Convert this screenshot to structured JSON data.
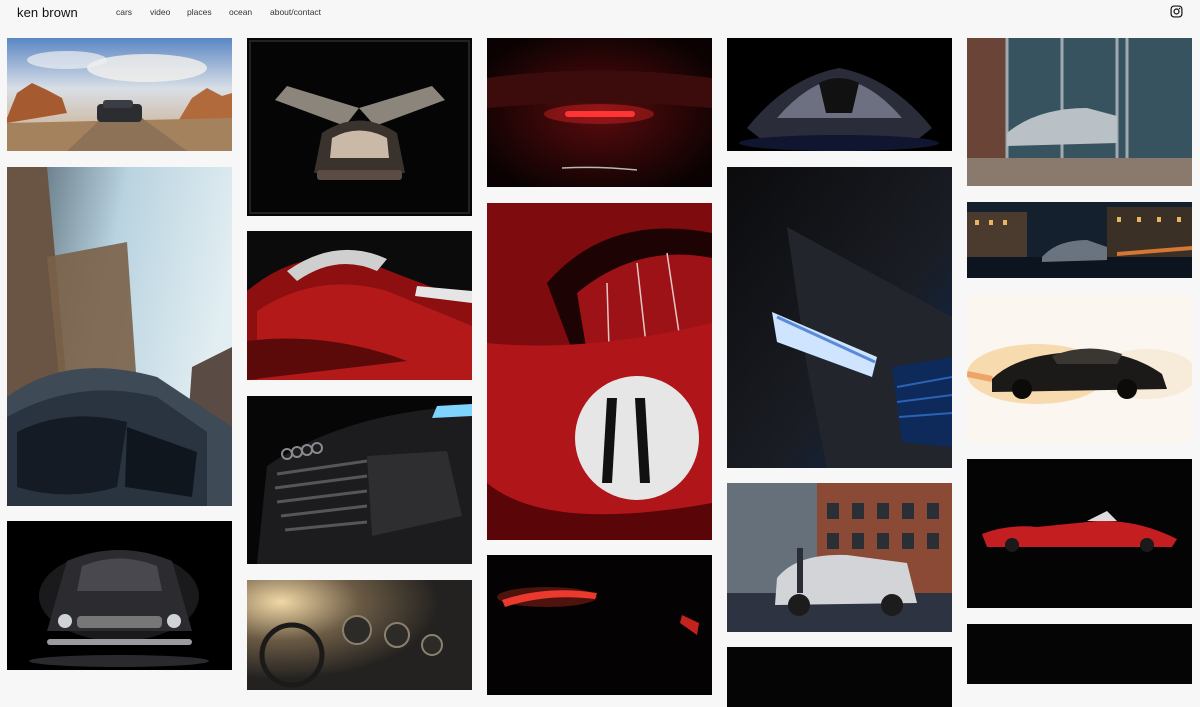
{
  "header": {
    "brand": "ken brown",
    "nav": [
      "cars",
      "video",
      "places",
      "ocean",
      "about/contact"
    ],
    "instagram_icon": "instagram-icon"
  },
  "gallery": {
    "columns": [
      {
        "tiles": [
          {
            "name": "photo-desert-suv"
          },
          {
            "name": "photo-bmw-skyscrapers"
          },
          {
            "name": "photo-classic-car-front-dark"
          }
        ]
      },
      {
        "tiles": [
          {
            "name": "photo-gullwing-doors"
          },
          {
            "name": "photo-red-race-car-curves"
          },
          {
            "name": "photo-audi-grille"
          },
          {
            "name": "photo-vintage-dashboard"
          }
        ]
      },
      {
        "tiles": [
          {
            "name": "photo-maserati-taillight"
          },
          {
            "name": "photo-red-number-11-racer"
          },
          {
            "name": "photo-red-light-streak"
          }
        ]
      },
      {
        "tiles": [
          {
            "name": "photo-supercar-front-dark"
          },
          {
            "name": "photo-audi-headlight-blue"
          },
          {
            "name": "photo-suv-brick-building"
          },
          {
            "name": "photo-dark-bottom-tile"
          }
        ]
      },
      {
        "tiles": [
          {
            "name": "photo-suv-glass-reflection"
          },
          {
            "name": "photo-city-night-car"
          },
          {
            "name": "photo-classic-coupe-white"
          },
          {
            "name": "photo-red-roadster-black"
          },
          {
            "name": "photo-dark-bottom-tile"
          }
        ]
      }
    ]
  }
}
